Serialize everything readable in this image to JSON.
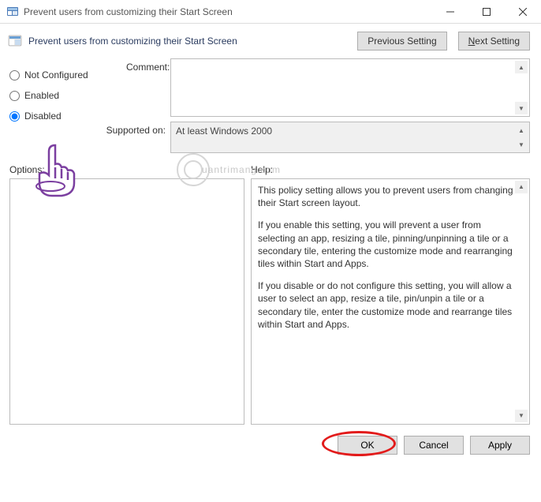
{
  "window": {
    "title": "Prevent users from customizing their Start Screen"
  },
  "header": {
    "title": "Prevent users from customizing their Start Screen",
    "prev_btn": "Previous Setting",
    "next_btn_prefix": "N",
    "next_btn_rest": "ext Setting"
  },
  "radios": {
    "not_configured": "Not Configured",
    "enabled": "Enabled",
    "disabled": "Disabled",
    "selected": "disabled"
  },
  "fields": {
    "comment_label": "Comment:",
    "comment_value": "",
    "supported_label": "Supported on:",
    "supported_value": "At least Windows 2000"
  },
  "sections": {
    "options_label": "Options:",
    "help_label": "Help:"
  },
  "help": {
    "p1": "This policy setting allows you to prevent users from changing their Start screen layout.",
    "p2": "If you enable this setting, you will prevent a user from selecting an app, resizing a tile, pinning/unpinning a tile or a secondary tile, entering the customize mode and rearranging tiles within Start and Apps.",
    "p3": "If you disable or do not configure this setting, you will allow a user to select an app, resize a tile, pin/unpin a tile or a secondary tile, enter the customize mode and rearrange tiles within Start and Apps."
  },
  "footer": {
    "ok": "OK",
    "cancel": "Cancel",
    "apply": "Apply"
  },
  "watermark": {
    "text": "uantrimang"
  }
}
